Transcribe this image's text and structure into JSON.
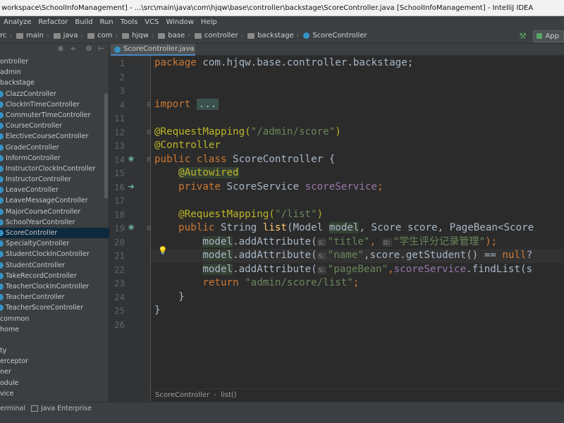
{
  "window_title": "workspace\\SchoolInfoManagement] - ...\\src\\main\\java\\com\\hjqw\\base\\controller\\backstage\\ScoreController.java [SchoolInfoManagement] - IntelliJ IDEA",
  "menu": [
    "Analyze",
    "Refactor",
    "Build",
    "Run",
    "Tools",
    "VCS",
    "Window",
    "Help"
  ],
  "breadcrumbs": [
    "rc",
    "main",
    "java",
    "com",
    "hjqw",
    "base",
    "controller",
    "backstage",
    "ScoreController"
  ],
  "run_config": "App",
  "sidebar_tree": [
    {
      "label": "ontroller",
      "type": "pkg"
    },
    {
      "label": "admin",
      "type": "pkg"
    },
    {
      "label": "backstage",
      "type": "pkg"
    },
    {
      "label": "ClazzController",
      "type": "cls"
    },
    {
      "label": "ClockInTimeController",
      "type": "cls"
    },
    {
      "label": "CommuterTimeController",
      "type": "cls"
    },
    {
      "label": "CourseController",
      "type": "cls"
    },
    {
      "label": "ElectiveCourseController",
      "type": "cls"
    },
    {
      "label": "GradeController",
      "type": "cls"
    },
    {
      "label": "InformController",
      "type": "cls"
    },
    {
      "label": "InstructorClockInController",
      "type": "cls"
    },
    {
      "label": "InstructorController",
      "type": "cls"
    },
    {
      "label": "LeaveController",
      "type": "cls"
    },
    {
      "label": "LeaveMessageController",
      "type": "cls"
    },
    {
      "label": "MajorCourseController",
      "type": "cls"
    },
    {
      "label": "SchoolYearController",
      "type": "cls"
    },
    {
      "label": "ScoreController",
      "type": "cls",
      "selected": true
    },
    {
      "label": "SpecialtyController",
      "type": "cls"
    },
    {
      "label": "StudentClockInController",
      "type": "cls"
    },
    {
      "label": "StudentController",
      "type": "cls"
    },
    {
      "label": "TakeRecordController",
      "type": "cls"
    },
    {
      "label": "TeacherClockInController",
      "type": "cls"
    },
    {
      "label": "TeacherController",
      "type": "cls"
    },
    {
      "label": "TeacherScoreController",
      "type": "cls"
    },
    {
      "label": "common",
      "type": "pkg"
    },
    {
      "label": "home",
      "type": "pkg"
    },
    {
      "label": "",
      "type": "pkg"
    },
    {
      "label": "ty",
      "type": "pkg"
    },
    {
      "label": "erceptor",
      "type": "pkg"
    },
    {
      "label": "ner",
      "type": "pkg"
    },
    {
      "label": "odule",
      "type": "pkg"
    },
    {
      "label": "vice",
      "type": "pkg"
    }
  ],
  "editor_tab": "ScoreController.java",
  "line_numbers": [
    "1",
    "2",
    "3",
    "4",
    "11",
    "12",
    "13",
    "14",
    "15",
    "16",
    "17",
    "18",
    "19",
    "20",
    "21",
    "22",
    "23",
    "24",
    "25",
    "26"
  ],
  "code": {
    "l1_kw": "package",
    "l1_rest": " com.hjqw.base.controller.backstage;",
    "l4_kw": "import",
    "l4_fold": "...",
    "l12_an": "@RequestMapping(",
    "l12_str": "\"/admin/score\"",
    "l12_end": ")",
    "l13_an": "@Controller",
    "l14_kw": "public class",
    "l14_rest": " ScoreController {",
    "l15_an": "@Autowired",
    "l16_kw": "private",
    "l16_type": " ScoreService ",
    "l16_field": "scoreService",
    "l16_end": ";",
    "l18_an": "@RequestMapping(",
    "l18_str": "\"/list\"",
    "l18_end": ")",
    "l19_kw": "public",
    "l19_type": " String ",
    "l19_method": "list",
    "l19_p1": "(Model ",
    "l19_model": "model",
    "l19_rest": ", Score score, PageBean<Score",
    "model": "model",
    "add_attr": ".addAttribute(",
    "hint_s": "s:",
    "hint_o": "o:",
    "l20_str1": "\"title\"",
    "l20_comma": ",",
    "l20_str2": "\"学生评分记录管理\"",
    "l20_end": ");",
    "l21_str": "\"name\"",
    "l21_mid": ",score.getStudent() == ",
    "l21_null": "null",
    "l21_end": "?",
    "l22_str": "\"pageBean\"",
    "l22_comma": ",",
    "l22_field": "scoreService",
    "l22_end": ".findList(s",
    "l23_kw": "return",
    "l23_str": "\"admin/score/list\"",
    "l23_end": ";",
    "l24": "}",
    "l25": "}"
  },
  "bottom_breadcrumb": [
    "ScoreController",
    "list()"
  ],
  "status": {
    "terminal": "erminal",
    "java_enterprise": "Java Enterprise"
  }
}
